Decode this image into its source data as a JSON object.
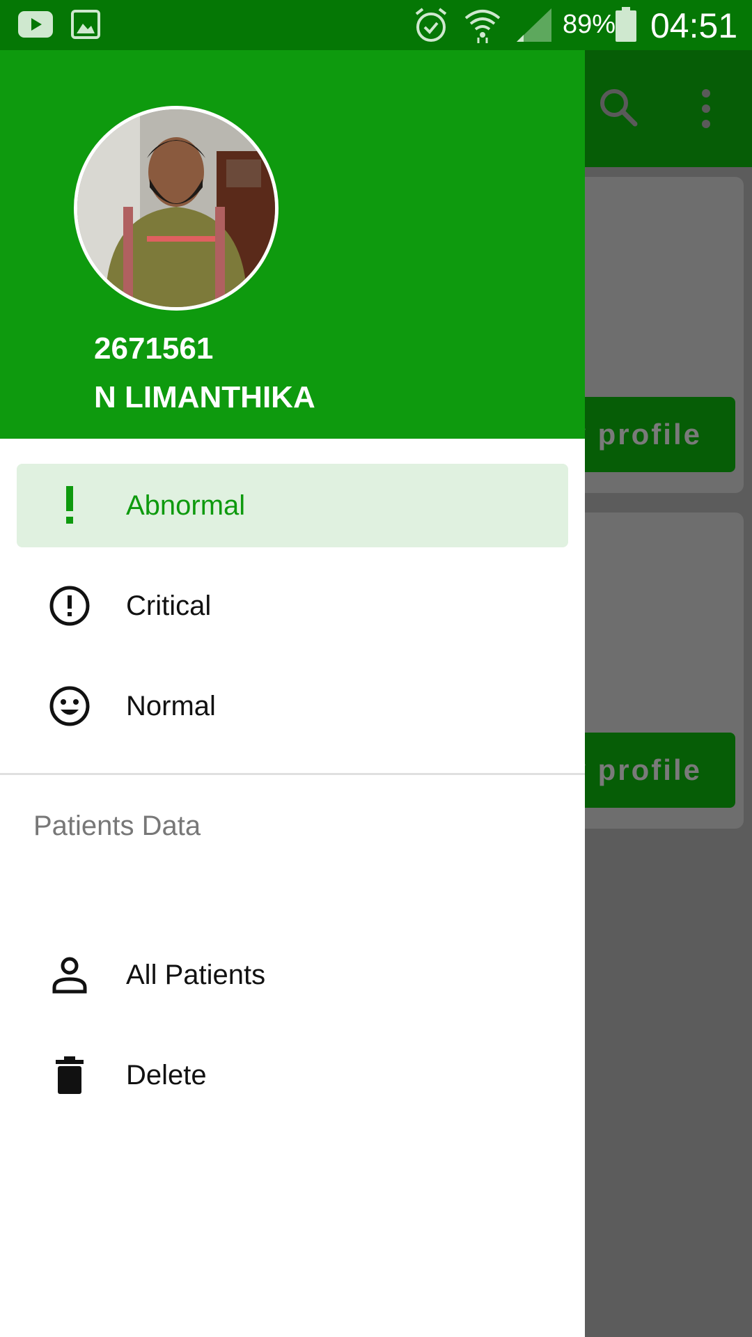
{
  "status_bar": {
    "battery_percent": "89%",
    "time": "04:51",
    "icons": [
      "youtube-icon",
      "image-icon",
      "alarm-icon",
      "wifi-icon",
      "signal-icon",
      "battery-icon"
    ]
  },
  "background_app": {
    "toolbar_icons": [
      "search-icon",
      "more-vert-icon"
    ],
    "card_button_label": "y profile"
  },
  "drawer": {
    "header": {
      "id": "2671561",
      "name": "N LIMANTHIKA"
    },
    "items": [
      {
        "label": "Abnormal",
        "icon": "exclamation-icon",
        "selected": true
      },
      {
        "label": "Critical",
        "icon": "alert-circle-icon",
        "selected": false
      },
      {
        "label": "Normal",
        "icon": "smiley-icon",
        "selected": false
      }
    ],
    "section": {
      "title": "Patients Data",
      "items": [
        {
          "label": "All Patients",
          "icon": "person-icon"
        },
        {
          "label": "Delete",
          "icon": "trash-icon"
        }
      ]
    }
  },
  "colors": {
    "primary": "#0e9a0e",
    "status_bar": "#057705",
    "selected_bg": "#e0f1e0",
    "scrim_bg": "#5c5c5c"
  }
}
